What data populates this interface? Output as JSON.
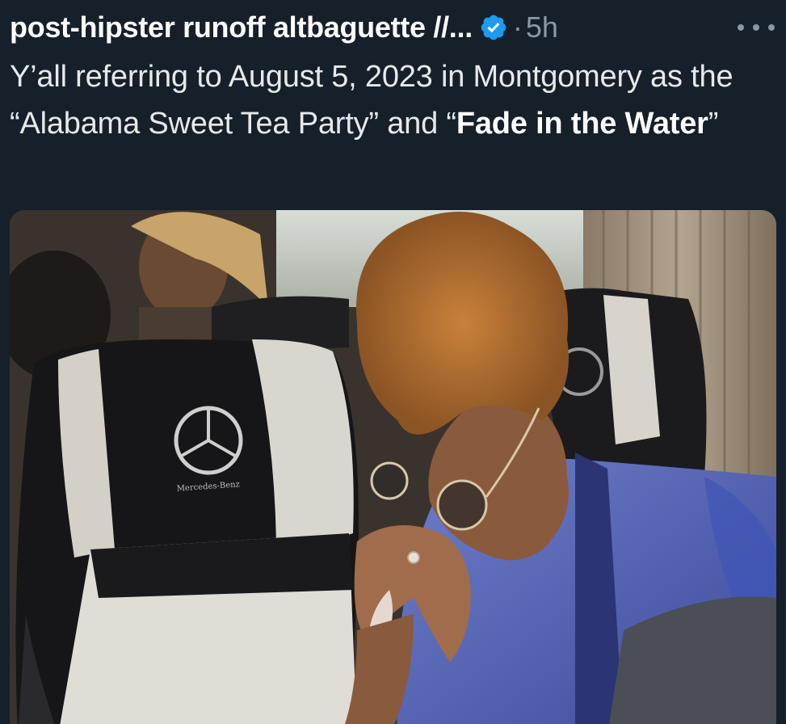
{
  "tweet": {
    "display_name": "post-hipster runoff altbaguette //...",
    "separator": "·",
    "time": "5h",
    "text_part1": "Y’all referring to August 5, 2023 in Montgomery as the “Alabama Sweet Tea Party” and “",
    "text_bold": "Fade in the Water",
    "text_part3": "”",
    "verified_icon": "verified-badge-icon",
    "more_icon": "more-options-icon"
  },
  "media": {
    "seat_logo_text": "Mercedes-Benz"
  },
  "colors": {
    "background": "#15202b",
    "secondary_text": "#8b98a5",
    "verified_blue": "#1d9bf0"
  }
}
